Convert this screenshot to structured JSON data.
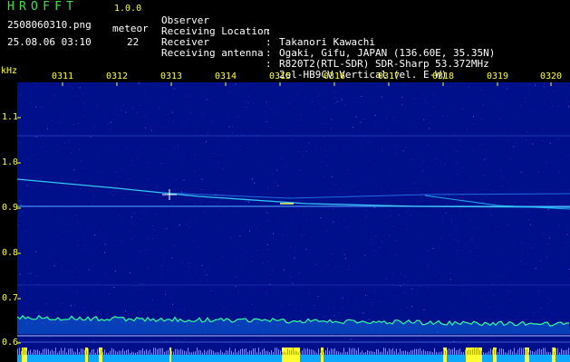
{
  "app": {
    "title": "HROFFT",
    "version": "1.0.0",
    "file_name": "2508060310.png",
    "timestamp": "25.08.06 03:10",
    "meteor_label": "meteor",
    "meteor_count": "22"
  },
  "info": [
    {
      "label": "Observer",
      "value": "Takanori Kawachi"
    },
    {
      "label": "Receiving Location",
      "value": "Ogaki, Gifu, JAPAN (136.60E, 35.35N)"
    },
    {
      "label": "Receiver",
      "value": "R820T2(RTL-SDR) SDR-Sharp 53.372MHz"
    },
    {
      "label": "Receiving antenna",
      "value": "2el-HB9CV Vertical (el. E-W)"
    }
  ],
  "axis": {
    "freq_unit": "kHz",
    "time_ticks": [
      "0311",
      "0312",
      "0313",
      "0314",
      "0315",
      "0316",
      "0317",
      "0318",
      "0319",
      "0320"
    ],
    "freq_ticks": [
      "1.1",
      "1.0",
      "0.9",
      "0.8",
      "0.7",
      "0.6"
    ]
  },
  "colors": {
    "header_green": "#46e046",
    "header_yellow": "#ffff38",
    "background_blue": "#00108a",
    "signal_cyan": "#20d8ff",
    "meteor_yellow": "#ffff30"
  }
}
